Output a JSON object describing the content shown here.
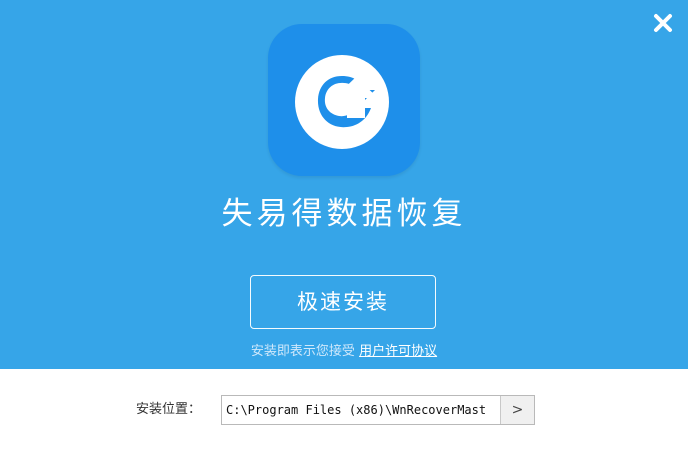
{
  "app": {
    "title": "失易得数据恢复"
  },
  "window": {
    "close_icon": "close-icon"
  },
  "install": {
    "button_label": "极速安装"
  },
  "agreement": {
    "text": "安装即表示您接受 ",
    "link_text": "用户许可协议"
  },
  "install_path": {
    "label": "安装位置：",
    "value": "C:\\Program Files (x86)\\WnRecoverMast",
    "browse_label": ">"
  },
  "colors": {
    "panel": "#36a5e8",
    "icon_bg": "#1e8fea",
    "text": "#ffffff"
  }
}
